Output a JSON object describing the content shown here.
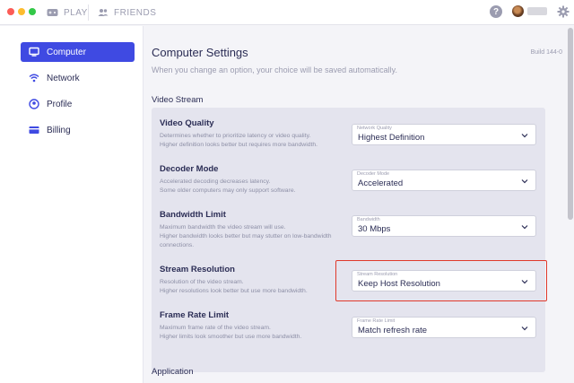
{
  "colors": {
    "accent": "#3f4ae2",
    "highlight": "#e0392b",
    "traffic_close": "#fc5c57",
    "traffic_min": "#fdbc2e",
    "traffic_max": "#33c848"
  },
  "topnav": {
    "tabs": [
      {
        "label": "PLAY",
        "icon": "gamepad-icon"
      },
      {
        "label": "FRIENDS",
        "icon": "friends-icon"
      }
    ],
    "help_label": "?"
  },
  "sidebar": {
    "items": [
      {
        "label": "Computer",
        "icon": "monitor-icon",
        "active": true
      },
      {
        "label": "Network",
        "icon": "wifi-icon"
      },
      {
        "label": "Profile",
        "icon": "user-icon"
      },
      {
        "label": "Billing",
        "icon": "card-icon"
      }
    ]
  },
  "main": {
    "title": "Computer Settings",
    "build": "Build 144-0",
    "subtitle": "When you change an option, your choice will be saved automatically.",
    "sections": [
      {
        "label": "Video Stream"
      },
      {
        "label": "Application"
      }
    ],
    "settings": [
      {
        "title": "Video Quality",
        "desc1": "Determines whether to prioritize latency or video quality.",
        "desc2": "Higher definition looks better but requires more bandwidth.",
        "field_label": "Network Quality",
        "value": "Highest Definition"
      },
      {
        "title": "Decoder Mode",
        "desc1": "Accelerated decoding decreases latency.",
        "desc2": "Some older computers may only support software.",
        "field_label": "Decoder Mode",
        "value": "Accelerated"
      },
      {
        "title": "Bandwidth Limit",
        "desc1": "Maximum bandwidth the video stream will use.",
        "desc2": "Higher bandwidth looks better but may stutter on low-bandwidth connections.",
        "field_label": "Bandwidth",
        "value": "30 Mbps"
      },
      {
        "title": "Stream Resolution",
        "desc1": "Resolution of the video stream.",
        "desc2": "Higher resolutions look better but use more bandwidth.",
        "field_label": "Stream Resolution",
        "value": "Keep Host Resolution"
      },
      {
        "title": "Frame Rate Limit",
        "desc1": "Maximum frame rate of the video stream.",
        "desc2": "Higher limits look smoother but use more bandwidth.",
        "field_label": "Frame Rate Limit",
        "value": "Match refresh rate"
      }
    ]
  }
}
